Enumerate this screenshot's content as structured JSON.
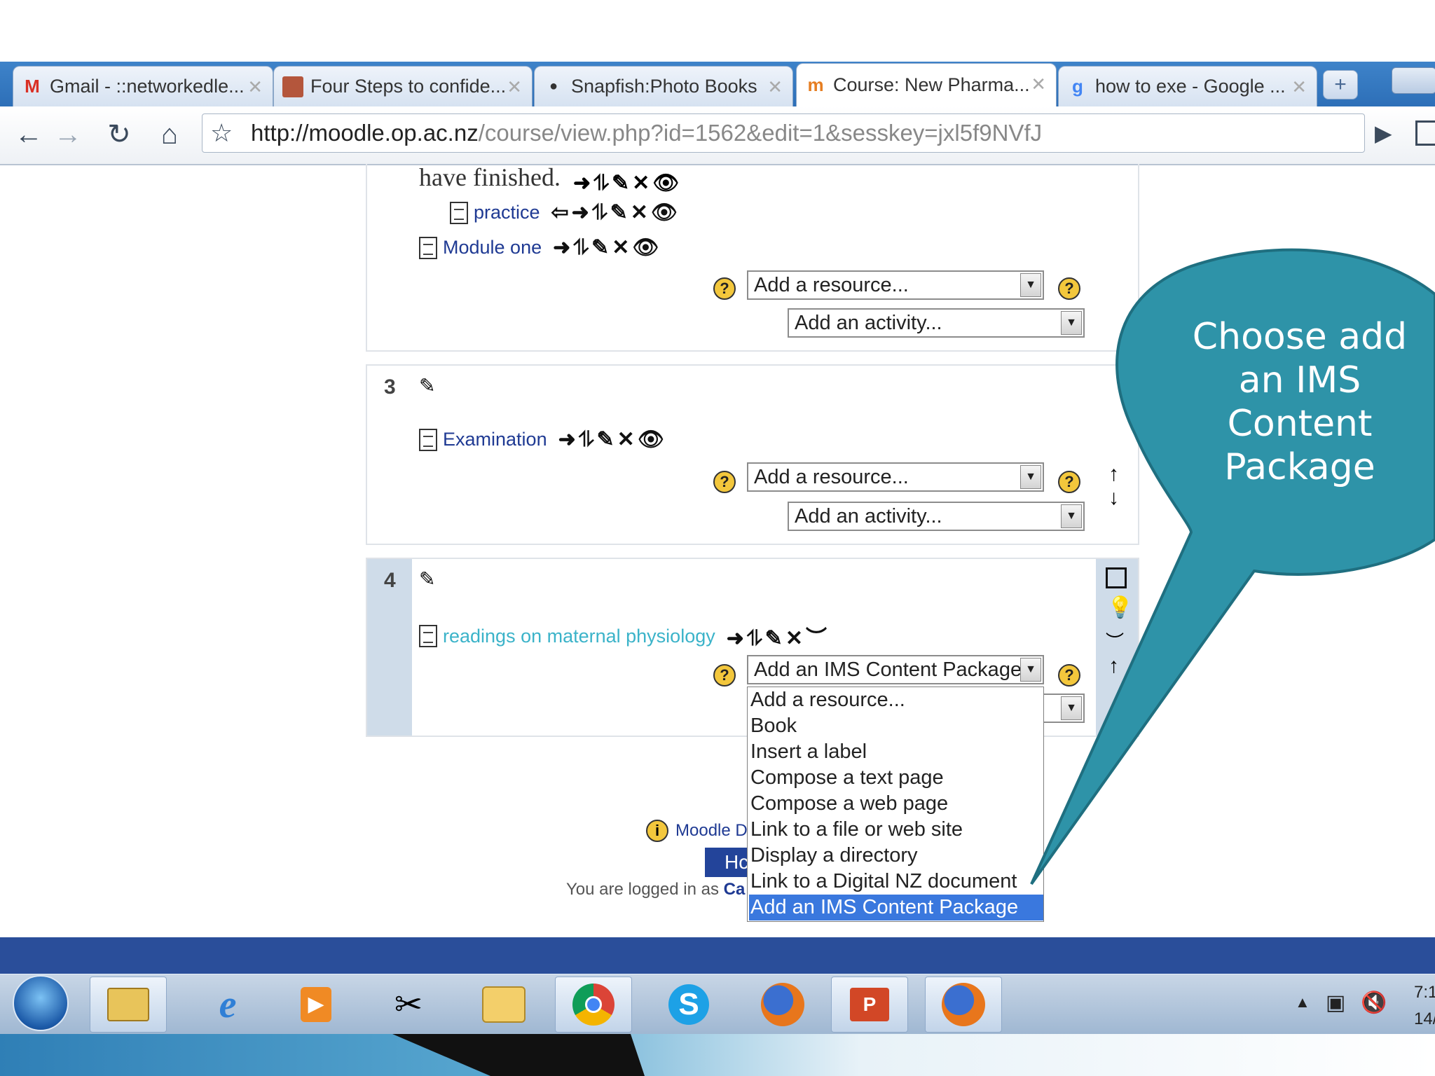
{
  "browser": {
    "tabs": [
      {
        "label": "Gmail - ::networkedle...",
        "icon": "gmail-icon"
      },
      {
        "label": "Four Steps to confide...",
        "icon": "page-thumbnail-icon"
      },
      {
        "label": "Snapfish:Photo Books",
        "icon": "snapfish-icon"
      },
      {
        "label": "Course: New Pharma...",
        "icon": "moodle-icon",
        "active": true
      },
      {
        "label": "how to exe - Google ...",
        "icon": "google-icon"
      }
    ],
    "url_domain": "http://moodle.op.ac.nz",
    "url_path": "/course/view.php?id=1562&edit=1&sesskey=jxl5f9NVfJ"
  },
  "page": {
    "section2": {
      "heading_text": "have finished.",
      "items": [
        {
          "label": "practice"
        },
        {
          "label": "Module one"
        }
      ],
      "add_resource": "Add a resource...",
      "add_activity": "Add an activity..."
    },
    "section3": {
      "number": "3",
      "items": [
        {
          "label": "Examination"
        }
      ],
      "add_resource": "Add a resource...",
      "add_activity": "Add an activity..."
    },
    "section4": {
      "number": "4",
      "items": [
        {
          "label": "readings on maternal physiology"
        }
      ],
      "select_value": "Add an IMS Content Package"
    },
    "dropdown_options": [
      "Add a resource...",
      "Book",
      "Insert a label",
      "Compose a text page",
      "Compose a web page",
      "Link to a file or web site",
      "Display a directory",
      "Link to a Digital NZ document",
      "Add an IMS Content Package"
    ],
    "selected_option_index": 8,
    "footer": {
      "docs_link": "Moodle Dc",
      "home_button": "Hc",
      "logged_in": "You are logged in as",
      "logged_user": "Ca"
    }
  },
  "callout": {
    "text_lines": [
      "Choose add",
      "an IMS",
      "Content",
      "Package"
    ],
    "color": "#2e93a8"
  },
  "taskbar": {
    "icons": [
      "start-orb",
      "explorer-icon",
      "internet-explorer-icon",
      "media-player-icon",
      "tools-icon",
      "outlook-icon",
      "chrome-icon",
      "skype-icon",
      "firefox-icon",
      "powerpoint-icon",
      "firefox-icon"
    ],
    "clock_time": "7:1",
    "clock_date": "14/"
  },
  "colors": {
    "link": "#1f3a93",
    "link_hidden": "#3bb3c9",
    "highlight": "#3a78de",
    "taskbar_band": "#2a4e9a"
  }
}
